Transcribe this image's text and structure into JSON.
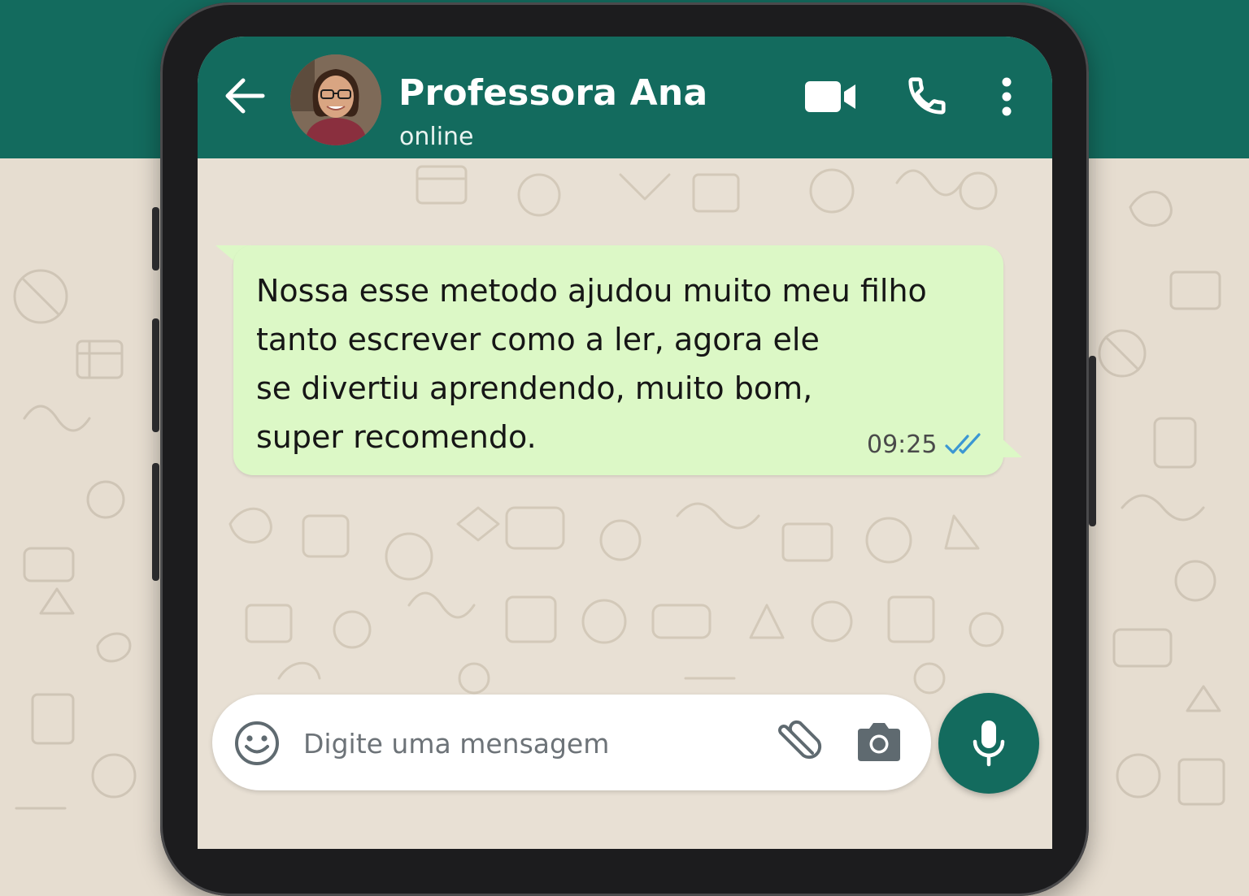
{
  "colors": {
    "header_green": "#136b5e",
    "bubble_green": "#dcf8c6",
    "wallpaper": "#e8e0d4",
    "read_ticks": "#3b97d3"
  },
  "header": {
    "back_icon": "arrow-left-icon",
    "contact_name": "Professora Ana",
    "status": "online",
    "video_icon": "video-camera-icon",
    "call_icon": "phone-icon",
    "menu_icon": "more-vertical-icon"
  },
  "message": {
    "text": "Nossa esse metodo ajudou muito meu filho\ntanto escrever como a ler, agora ele\nse divertiu aprendendo, muito bom,\nsuper recomendo.",
    "time": "09:25",
    "status_icon": "double-check-read-icon"
  },
  "composer": {
    "emoji_icon": "emoji-smile-icon",
    "placeholder": "Digite uma mensagem",
    "attach_icon": "paperclip-icon",
    "camera_icon": "camera-icon",
    "mic_icon": "microphone-icon"
  }
}
